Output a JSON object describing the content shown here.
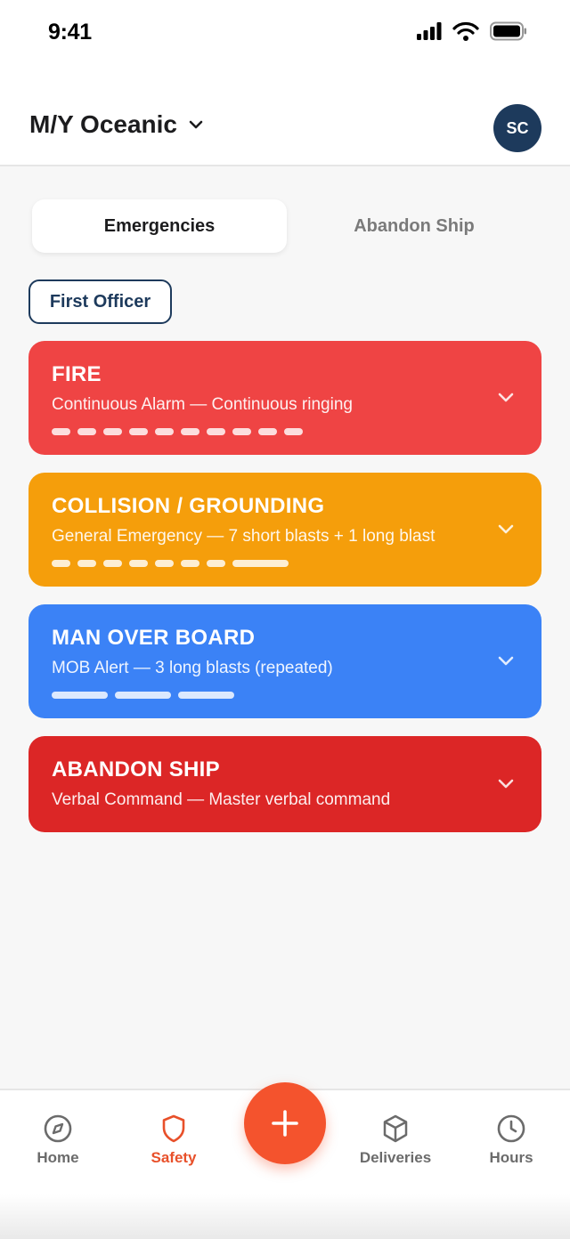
{
  "status_bar": {
    "time": "9:41",
    "icons": [
      "cellular-signal-icon",
      "wifi-icon",
      "battery-icon"
    ]
  },
  "header": {
    "vessel_name": "M/Y Oceanic",
    "avatar_initials": "SC",
    "avatar_color": "#1d3a5c"
  },
  "segments": [
    {
      "label": "Emergencies",
      "active": true
    },
    {
      "label": "Abandon Ship",
      "active": false
    }
  ],
  "role_filter": {
    "label": "First Officer"
  },
  "emergencies": [
    {
      "title": "FIRE",
      "subtitle": "Continuous Alarm — Continuous ringing",
      "color": "#ef4444",
      "signal": "10 short dashes"
    },
    {
      "title": "COLLISION / GROUNDING",
      "subtitle": "General Emergency — 7 short blasts + 1 long blast",
      "color": "#f59e0b",
      "signal": "7 short + 1 long"
    },
    {
      "title": "MAN OVER BOARD",
      "subtitle": "MOB Alert — 3 long blasts (repeated)",
      "color": "#3b82f6",
      "signal": "3 long"
    },
    {
      "title": "ABANDON SHIP",
      "subtitle": "Verbal Command — Master verbal command",
      "color": "#dc2626",
      "signal": "none"
    }
  ],
  "tabbar": {
    "items": [
      {
        "label": "Home",
        "icon": "compass-icon",
        "active": false
      },
      {
        "label": "Safety",
        "icon": "shield-icon",
        "active": true
      },
      {
        "label": "Deliveries",
        "icon": "box-icon",
        "active": false
      },
      {
        "label": "Hours",
        "icon": "clock-icon",
        "active": false
      }
    ],
    "fab_icon": "plus-icon",
    "accent": "#f4532d"
  }
}
